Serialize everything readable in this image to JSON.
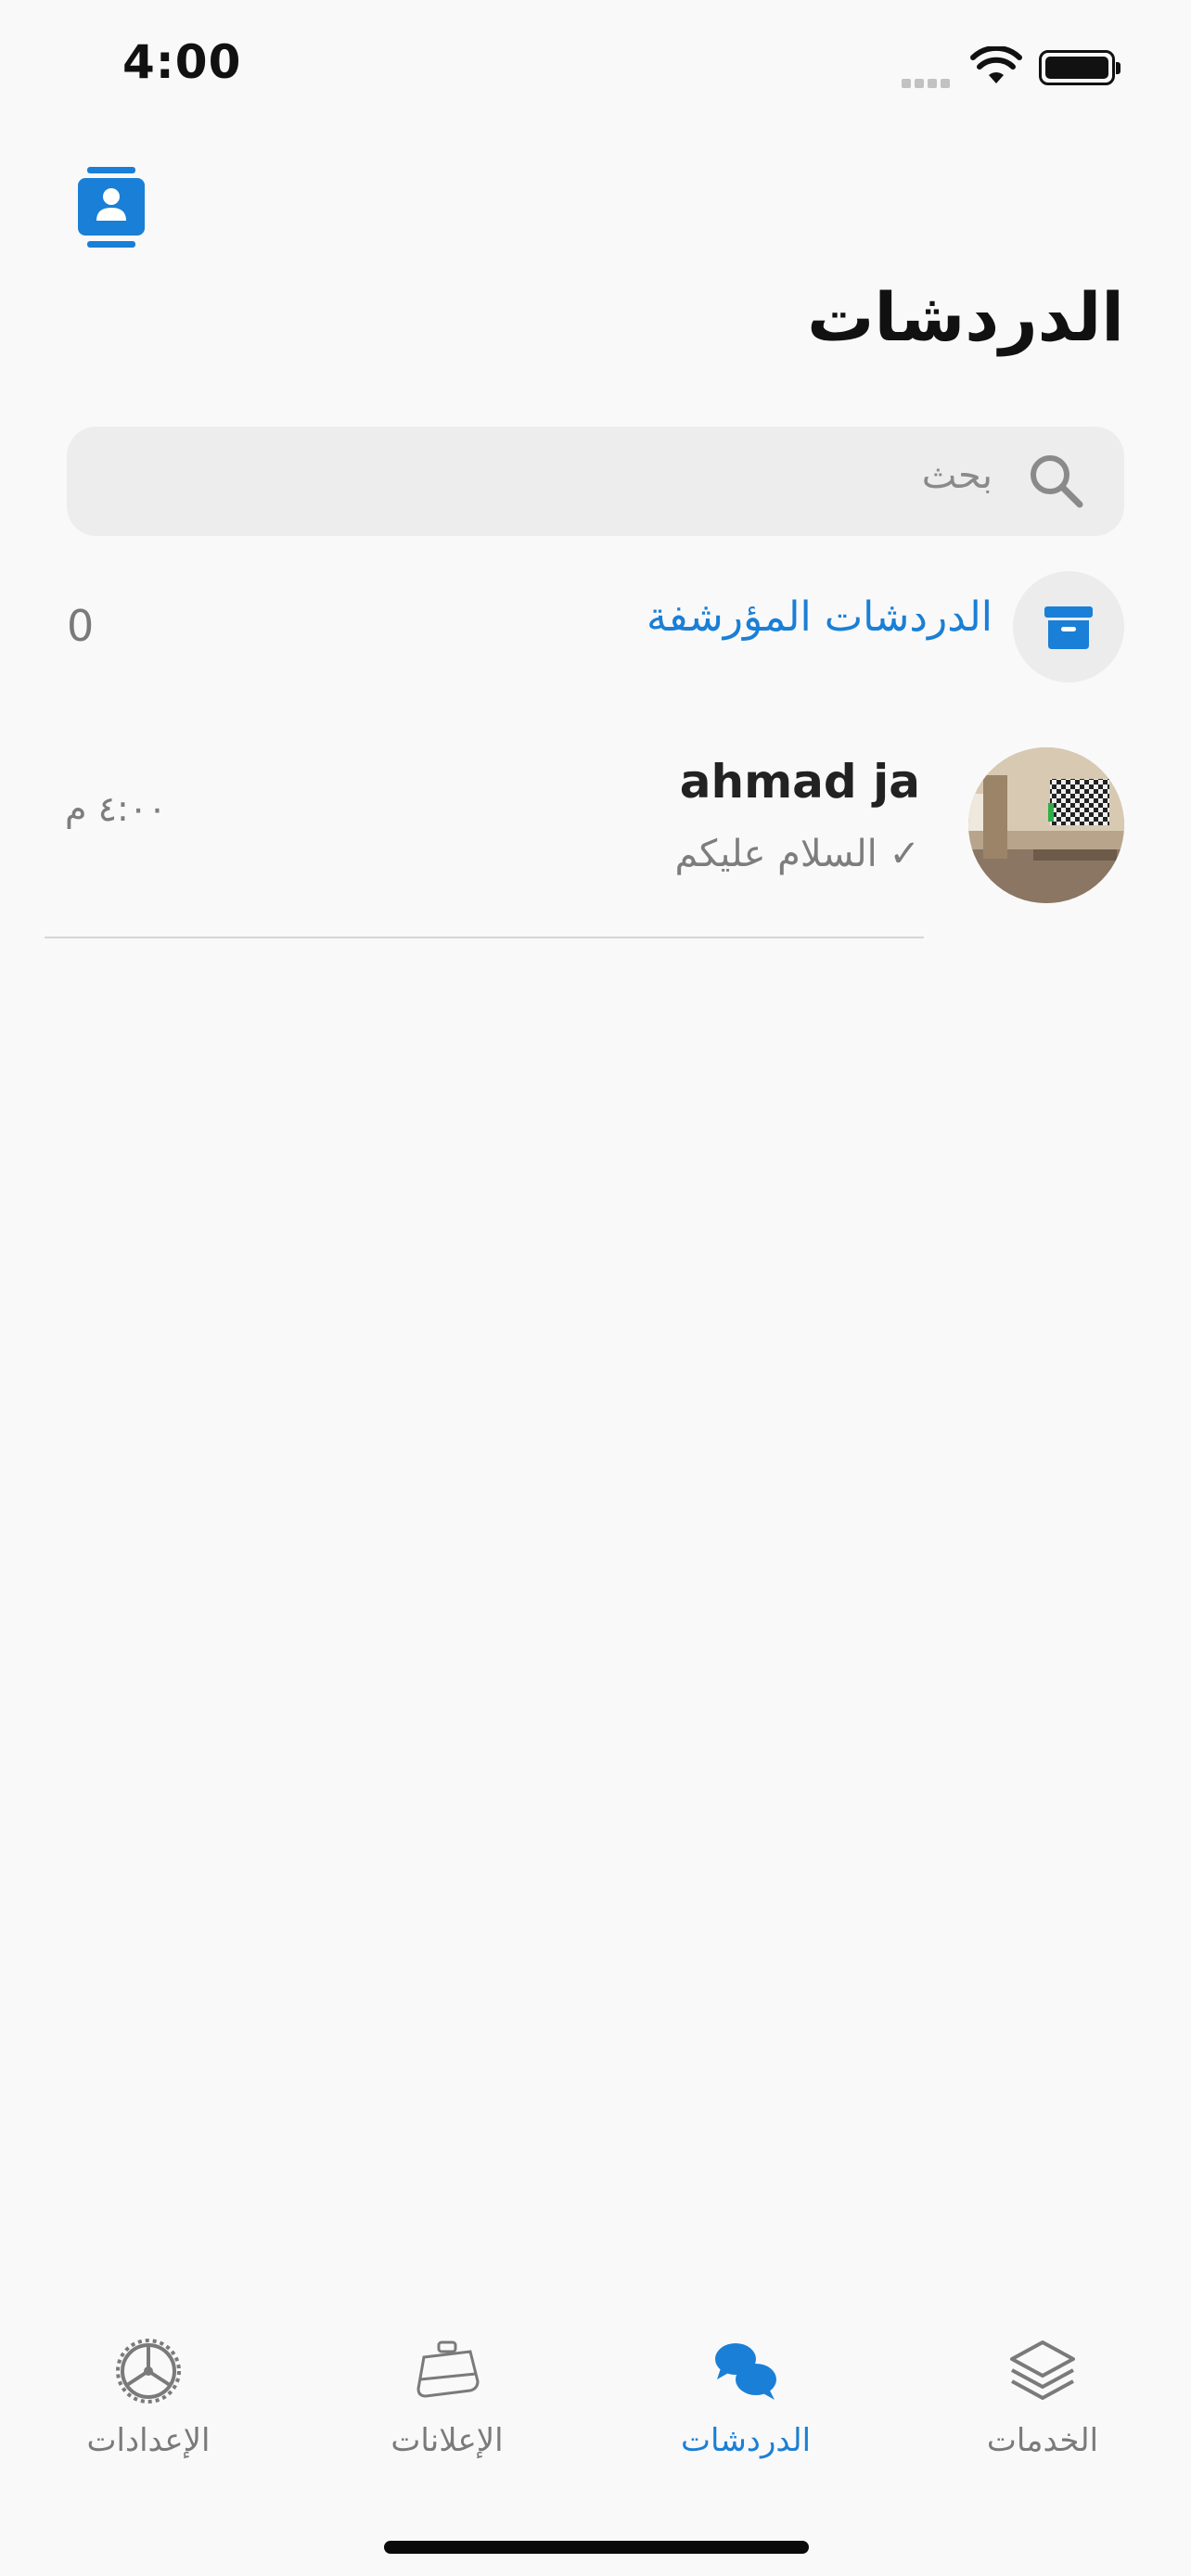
{
  "status_bar": {
    "time": "4:00"
  },
  "header": {
    "title": "الدردشات"
  },
  "search": {
    "placeholder": "بحث"
  },
  "archived": {
    "label": "الدردشات المؤرشفة",
    "count": "0"
  },
  "chats": [
    {
      "name": "ahmad ja",
      "preview": "✓ السلام عليكم",
      "time": "٤:٠٠ م"
    }
  ],
  "tabs": [
    {
      "label": "الإعدادات",
      "icon": "gear-icon",
      "active": false
    },
    {
      "label": "الإعلانات",
      "icon": "briefcase-icon",
      "active": false
    },
    {
      "label": "الدردشات",
      "icon": "chat-bubbles-icon",
      "active": true
    },
    {
      "label": "الخدمات",
      "icon": "layers-icon",
      "active": false
    }
  ],
  "colors": {
    "accent": "#1a7fd6",
    "background": "#f9f9f9",
    "search_bg": "#ededed"
  }
}
